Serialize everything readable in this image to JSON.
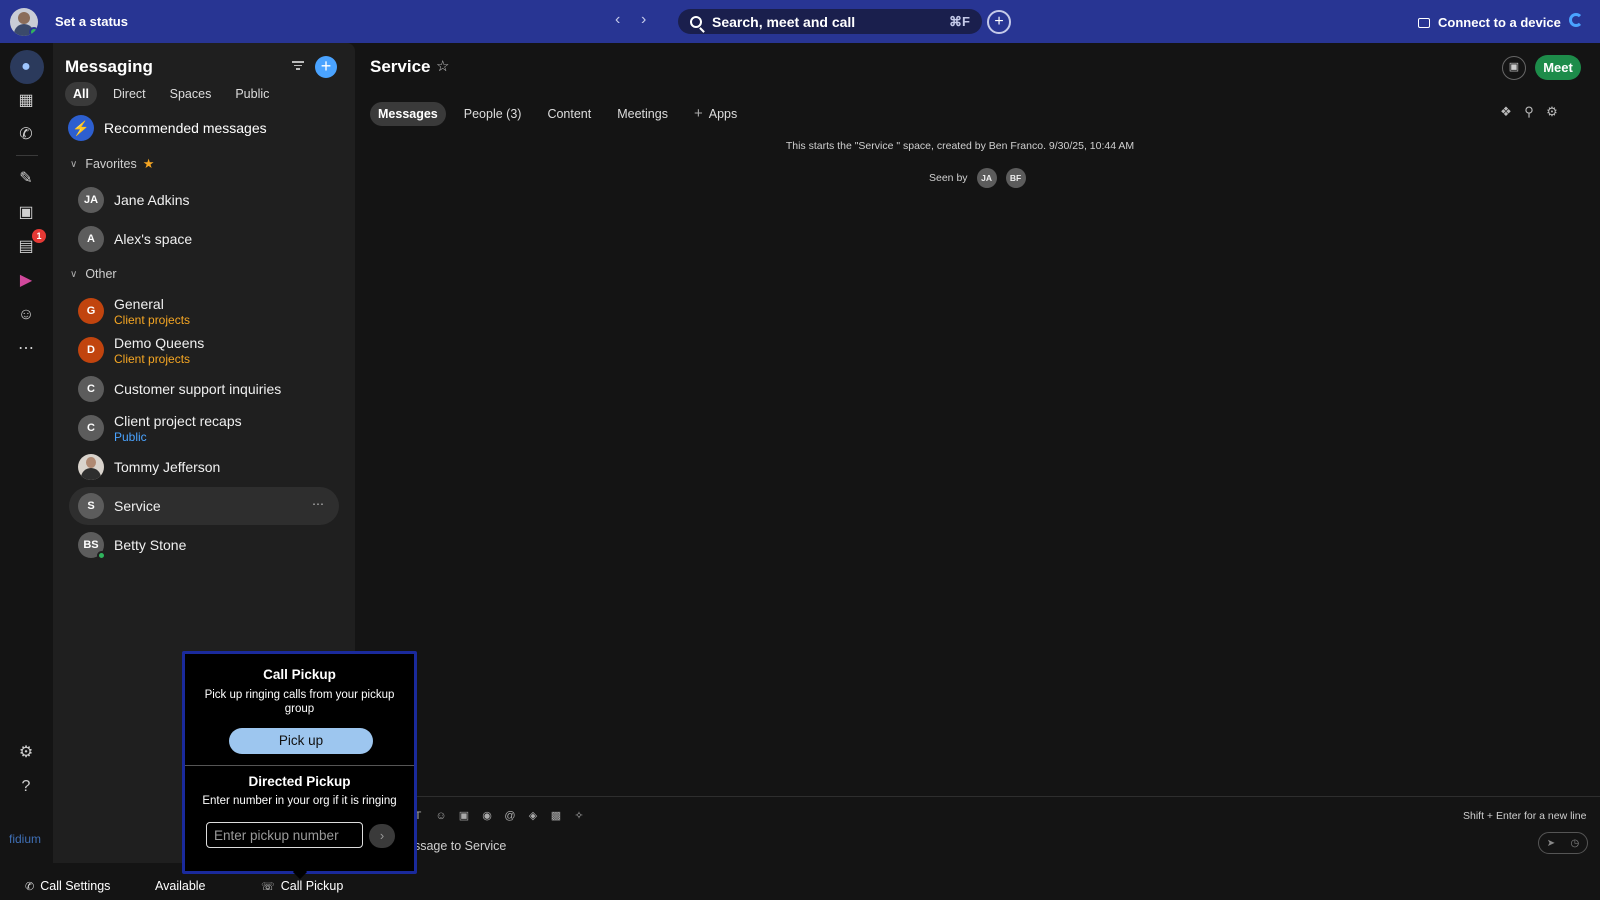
{
  "topbar": {
    "status_label": "Set a status",
    "search_label": "Search, meet and call",
    "search_shortcut": "⌘F",
    "connect_label": "Connect to a device"
  },
  "rail": {
    "voicemail_badge": "1",
    "brand": "fidium"
  },
  "messaging": {
    "title": "Messaging",
    "tabs": [
      "All",
      "Direct",
      "Spaces",
      "Public"
    ],
    "recommended": "Recommended messages",
    "favorites_label": "Favorites",
    "other_label": "Other",
    "favorites": [
      {
        "initials": "JA",
        "name": "Jane Adkins"
      },
      {
        "initials": "A",
        "name": "Alex's space"
      }
    ],
    "other": [
      {
        "initials": "G",
        "name": "General",
        "sub": "Client projects"
      },
      {
        "initials": "D",
        "name": "Demo Queens",
        "sub": "Client projects"
      },
      {
        "initials": "C",
        "name": "Customer support inquiries"
      },
      {
        "initials": "C",
        "name": "Client project recaps",
        "sub": "Public"
      },
      {
        "name": "Tommy Jefferson"
      },
      {
        "initials": "S",
        "name": "Service"
      },
      {
        "initials": "BS",
        "name": "Betty Stone"
      }
    ]
  },
  "space": {
    "title": "Service",
    "meet_label": "Meet",
    "tabs": [
      "Messages",
      "People (3)",
      "Content",
      "Meetings",
      "Apps"
    ],
    "start_note": "This starts the \"Service \" space, created by Ben Franco. 9/30/25, 10:44 AM",
    "seen_by_label": "Seen by",
    "seen_by": [
      "JA",
      "BF"
    ],
    "composer_hint": "Shift + Enter for a new line",
    "composer_placeholder": "essage to Service"
  },
  "popover": {
    "pickup_title": "Call Pickup",
    "pickup_desc": "Pick up ringing calls from your pickup group",
    "pickup_button": "Pick up",
    "directed_title": "Directed Pickup",
    "directed_desc": "Enter number in your org if it is ringing",
    "input_placeholder": "Enter pickup number"
  },
  "bottombar": {
    "call_settings": "Call Settings",
    "availability": "Available",
    "call_pickup": "Call Pickup"
  },
  "colors": {
    "topbar": "#283593",
    "accent": "#4aa3ff",
    "meet": "#1d8c4a",
    "favorite_star": "#f5a623",
    "popover_border": "#1a2a9c"
  }
}
